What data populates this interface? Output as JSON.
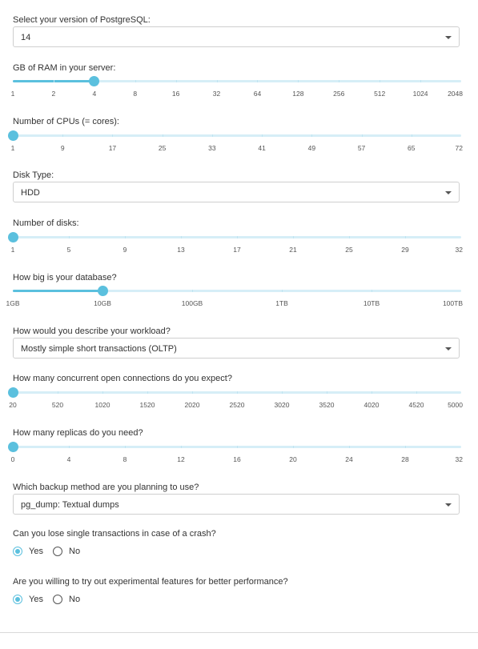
{
  "postgres_version": {
    "label": "Select your version of PostgreSQL:",
    "value": "14"
  },
  "ram": {
    "label": "GB of RAM in your server:",
    "ticks": [
      "1",
      "2",
      "4",
      "8",
      "16",
      "32",
      "64",
      "128",
      "256",
      "512",
      "1024",
      "2048"
    ],
    "selected_index": 2
  },
  "cpus": {
    "label": "Number of CPUs (= cores):",
    "ticks": [
      "1",
      "9",
      "17",
      "25",
      "33",
      "41",
      "49",
      "57",
      "65",
      "72"
    ],
    "value": 1,
    "min": 1,
    "max": 72
  },
  "disk_type": {
    "label": "Disk Type:",
    "value": "HDD"
  },
  "disks": {
    "label": "Number of disks:",
    "ticks": [
      "1",
      "5",
      "9",
      "13",
      "17",
      "21",
      "25",
      "29",
      "32"
    ],
    "value": 1,
    "min": 1,
    "max": 32
  },
  "db_size": {
    "label": "How big is your database?",
    "ticks": [
      "1GB",
      "10GB",
      "100GB",
      "1TB",
      "10TB",
      "100TB"
    ],
    "selected_index": 1
  },
  "workload": {
    "label": "How would you describe your workload?",
    "value": "Mostly simple short transactions (OLTP)"
  },
  "connections": {
    "label": "How many concurrent open connections do you expect?",
    "ticks": [
      "20",
      "520",
      "1020",
      "1520",
      "2020",
      "2520",
      "3020",
      "3520",
      "4020",
      "4520",
      "5000"
    ],
    "value": 20,
    "min": 20,
    "max": 5000
  },
  "replicas": {
    "label": "How many replicas do you need?",
    "ticks": [
      "0",
      "4",
      "8",
      "12",
      "16",
      "20",
      "24",
      "28",
      "32"
    ],
    "value": 0,
    "min": 0,
    "max": 32
  },
  "backup": {
    "label": "Which backup method are you planning to use?",
    "value": "pg_dump: Textual dumps"
  },
  "lose_transactions": {
    "label": "Can you lose single transactions in case of a crash?",
    "yes": "Yes",
    "no": "No",
    "selected": "yes"
  },
  "experimental": {
    "label": "Are you willing to try out experimental features for better performance?",
    "yes": "Yes",
    "no": "No",
    "selected": "yes"
  },
  "colors": {
    "accent": "#5bc0de",
    "track": "#d6eef7"
  }
}
